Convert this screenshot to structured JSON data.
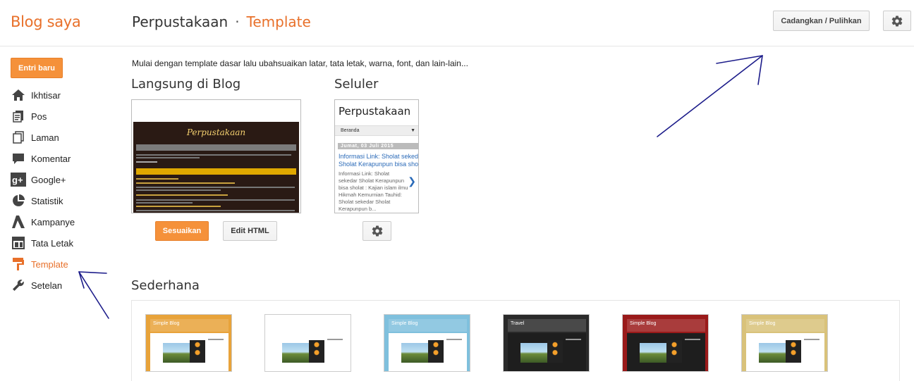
{
  "header": {
    "brand": "Blog saya",
    "breadcrumb_blog": "Perpustakaan",
    "breadcrumb_separator": "·",
    "breadcrumb_page": "Template",
    "backup_label": "Cadangkan / Pulihkan"
  },
  "sidebar": {
    "new_post_label": "Entri baru",
    "items": [
      {
        "label": "Ikhtisar",
        "icon": "home-icon"
      },
      {
        "label": "Pos",
        "icon": "posts-icon"
      },
      {
        "label": "Laman",
        "icon": "pages-icon"
      },
      {
        "label": "Komentar",
        "icon": "comment-icon"
      },
      {
        "label": "Google+",
        "icon": "google-plus-icon"
      },
      {
        "label": "Statistik",
        "icon": "pie-chart-icon"
      },
      {
        "label": "Kampanye",
        "icon": "adwords-icon"
      },
      {
        "label": "Tata Letak",
        "icon": "layout-icon"
      },
      {
        "label": "Template",
        "icon": "paint-roller-icon"
      },
      {
        "label": "Setelan",
        "icon": "wrench-icon"
      }
    ]
  },
  "main": {
    "intro": "Mulai dengan template dasar lalu ubahsuaikan latar, tata letak, warna, font, dan lain-lain...",
    "live_title": "Langsung di Blog",
    "desktop_preview_title": "Perpustakaan",
    "customize_label": "Sesuaikan",
    "edit_html_label": "Edit HTML",
    "mobile_title": "Seluler",
    "mobile_preview": {
      "blog_title": "Perpustakaan",
      "select": "Beranda",
      "date": "Jumat, 03 Juli 2015",
      "post_title": "Informasi Link: Sholat sekedar Sholat Kerapunpun bisa sholat",
      "post_body": "Informasi Link: Sholat sekedar Sholat Kerapunpun bisa sholat : Kajian islam ilmu Hikmah Kemurnian Tauhid: Sholat sekedar Sholat Kerapunpun b..."
    },
    "simple_title": "Sederhana",
    "templates": [
      {
        "title": "Simple Blog",
        "color": "#e8a33a"
      },
      {
        "title": "",
        "color": "#ffffff"
      },
      {
        "title": "Simple Blog",
        "color": "#7fc0dd"
      },
      {
        "title": "Travel",
        "color": "#2a2a2a"
      },
      {
        "title": "Simple Blog",
        "color": "#9a1a1a"
      },
      {
        "title": "Simple Blog",
        "color": "#d9c27a"
      }
    ]
  },
  "colors": {
    "accent": "#e8702a",
    "primary_button": "#f5913a",
    "annotation_arrow": "#1c1c8a"
  }
}
